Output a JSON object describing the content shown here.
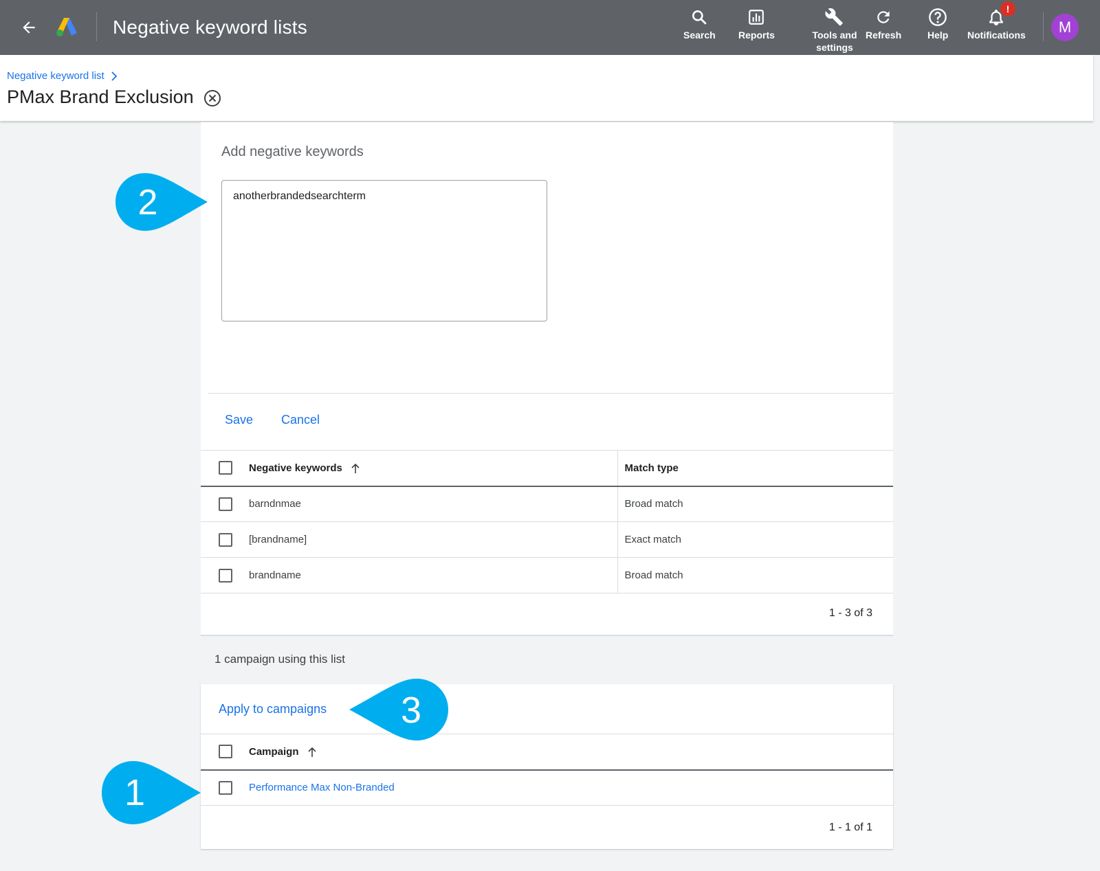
{
  "topbar": {
    "title": "Negative keyword lists",
    "tools": [
      {
        "label": "Search",
        "icon": "search-icon"
      },
      {
        "label": "Reports",
        "icon": "reports-icon"
      },
      {
        "label": "Tools and settings",
        "icon": "wrench-icon"
      },
      {
        "label": "Refresh",
        "icon": "refresh-icon"
      },
      {
        "label": "Help",
        "icon": "help-icon"
      },
      {
        "label": "Notifications",
        "icon": "bell-icon",
        "badge": "!"
      }
    ],
    "avatar_initial": "M"
  },
  "header": {
    "breadcrumb": "Negative keyword list",
    "title": "PMax Brand Exclusion"
  },
  "add_keywords": {
    "title": "Add negative keywords",
    "value": "anotherbrandedsearchterm",
    "save_label": "Save",
    "cancel_label": "Cancel"
  },
  "keywords_table": {
    "columns": [
      "Negative keywords",
      "Match type"
    ],
    "rows": [
      {
        "keyword": "barndnmae",
        "match": "Broad match"
      },
      {
        "keyword": "[brandname]",
        "match": "Exact match"
      },
      {
        "keyword": "brandname",
        "match": "Broad match"
      }
    ],
    "pagination": "1 - 3 of 3"
  },
  "campaigns": {
    "count_label": "1 campaign using this list",
    "apply_label": "Apply to campaigns",
    "column": "Campaign",
    "rows": [
      {
        "name": "Performance Max Non-Branded"
      }
    ],
    "pagination": "1 - 1 of 1"
  },
  "callouts": [
    "1",
    "2",
    "3"
  ],
  "colors": {
    "topbar": "#5f6368",
    "link": "#1a73e8",
    "callout": "#00aeef",
    "avatar": "#a142d4",
    "badge": "#d93025"
  }
}
